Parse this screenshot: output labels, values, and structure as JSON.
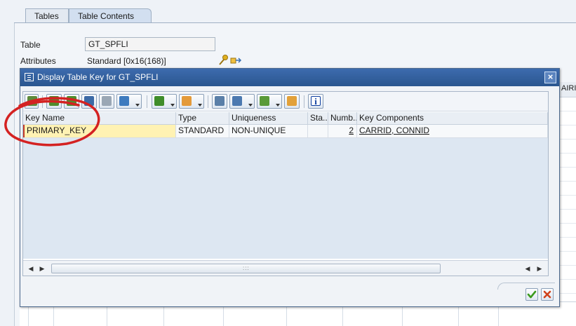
{
  "tabs": [
    {
      "label": "Tables",
      "active": false
    },
    {
      "label": "Table Contents",
      "active": true
    }
  ],
  "background": {
    "table_label": "Table",
    "table_value": "GT_SPFLI",
    "attributes_label": "Attributes",
    "attributes_value": "Standard [0x16(168)]",
    "grid_column_partial": "AIRI"
  },
  "dialog": {
    "title": "Display Table Key for GT_SPFLI",
    "close_symbol": "×",
    "toolbar_icons": [
      "details-icon",
      "sort-ascending-icon",
      "sort-descending-icon",
      "find-icon",
      "find-next-icon",
      "filter-icon",
      "total-icon",
      "subtotal-icon",
      "print-icon",
      "views-icon",
      "export-icon",
      "layout-icon",
      "info-icon"
    ],
    "info_symbol": "i",
    "columns": [
      "Key Name",
      "Type",
      "Uniqueness",
      "Sta...",
      "Numb...",
      "Key Components"
    ],
    "rows": [
      {
        "key_name": "PRIMARY_KEY",
        "type": "STANDARD",
        "uniqueness": "NON-UNIQUE",
        "status": "",
        "number": "2",
        "components": "CARRID, CONNID"
      }
    ],
    "scroll_left": "◀",
    "scroll_right": "▶",
    "scroll_grip": ":::"
  },
  "colors": {
    "titlebar": "#2f5e9e",
    "highlight_cell": "#fff2b3",
    "annotation_circle": "#d42222",
    "ok_check": "#3a9a1c",
    "cancel_x": "#d0421b"
  }
}
